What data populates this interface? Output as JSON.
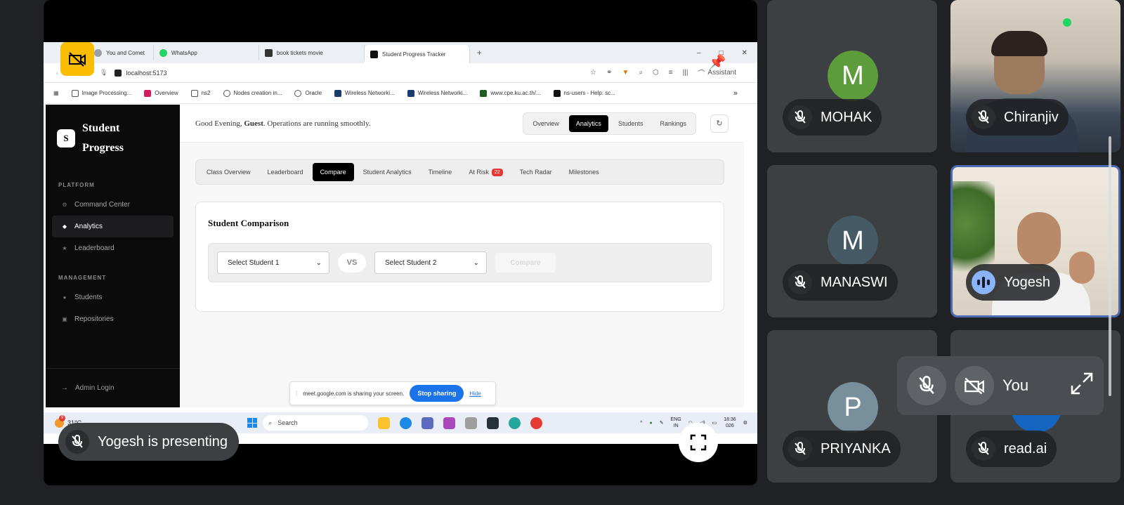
{
  "browser": {
    "tabs": [
      {
        "label": "You and Comet",
        "active": false
      },
      {
        "label": "WhatsApp",
        "active": false
      },
      {
        "label": "book tickets movie",
        "active": false
      },
      {
        "label": "Student Progress Tracker",
        "active": true
      }
    ],
    "new_tab": "+",
    "url": "localhost:5173",
    "assistant_label": "Assistant",
    "bookmarks": [
      "Image Processing...",
      "Overview",
      "ns2",
      "Nodes creation in...",
      "Oracle",
      "Wireless Networki...",
      "Wireless Networki...",
      "www.cpe.ku.ac.th/...",
      "ns-users - Help: sc..."
    ]
  },
  "app": {
    "logo_letter": "S",
    "brand": "Student Progress",
    "sections": {
      "platform": "PLATFORM",
      "management": "MANAGEMENT"
    },
    "nav_platform": [
      {
        "label": "Command Center",
        "active": false
      },
      {
        "label": "Analytics",
        "active": true
      },
      {
        "label": "Leaderboard",
        "active": false
      }
    ],
    "nav_management": [
      {
        "label": "Students",
        "active": false
      },
      {
        "label": "Repositories",
        "active": false
      }
    ],
    "admin_login": "Admin Login",
    "greeting_prefix": "Good Evening,",
    "greeting_user": "Guest",
    "greeting_suffix": ". Operations are running smoothly.",
    "top_nav": [
      "Overview",
      "Analytics",
      "Students",
      "Rankings"
    ],
    "top_nav_active": "Analytics",
    "subtabs": [
      "Class Overview",
      "Leaderboard",
      "Compare",
      "Student Analytics",
      "Timeline",
      "At Risk",
      "Tech Radar",
      "Milestones"
    ],
    "subtab_active": "Compare",
    "at_risk_count": "22",
    "compare": {
      "title": "Student Comparison",
      "select1": "Select Student 1",
      "vs": "VS",
      "select2": "Select Student 2",
      "button": "Compare"
    }
  },
  "share_bar": {
    "message": "meet.google.com is sharing your screen.",
    "stop": "Stop sharing",
    "hide": "Hide"
  },
  "taskbar": {
    "temperature": "31°C",
    "weather_badge": "9",
    "search_placeholder": "Search",
    "lang_top": "ENG",
    "lang_bottom": "IN",
    "time": "18:36",
    "date_partial": "026"
  },
  "meet": {
    "presenting_label": "Yogesh is presenting",
    "self_label": "You",
    "participants": [
      {
        "name": "MOHAK",
        "initial": "M",
        "color": "#5c9c3a"
      },
      {
        "name": "Chiranjiv",
        "initial": "",
        "color": ""
      },
      {
        "name": "MANASWI",
        "initial": "M",
        "color": "#455a64"
      },
      {
        "name": "Yogesh",
        "initial": "",
        "color": ""
      },
      {
        "name": "PRIYANKA",
        "initial": "P",
        "color": "#78909c"
      },
      {
        "name": "read.ai",
        "initial": "",
        "color": "#1565c0"
      }
    ]
  }
}
